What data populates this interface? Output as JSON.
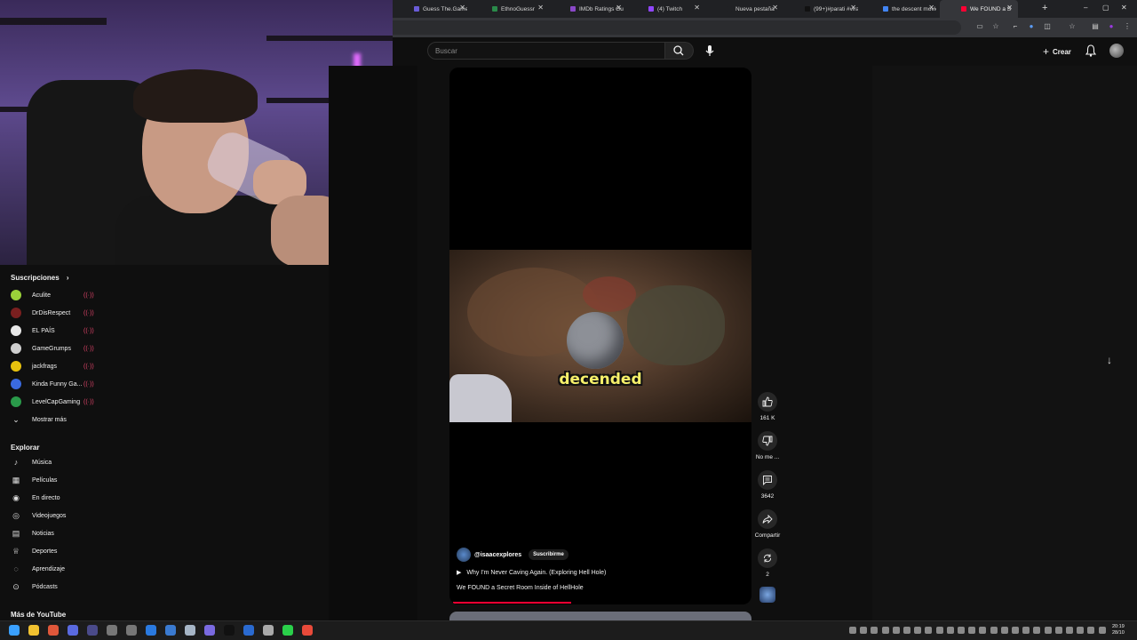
{
  "browser": {
    "tabs": [
      {
        "label": "Guess The.Game #",
        "icon_color": "#6a5cd8"
      },
      {
        "label": "EthnoGuessr",
        "icon_color": "#2a8a4a"
      },
      {
        "label": "IMDb Ratings Gues",
        "icon_color": "#8a48c8"
      },
      {
        "label": "(4) Twitch",
        "icon_color": "#9146ff"
      },
      {
        "label": "Nueva pestaña",
        "icon_color": "#202124"
      },
      {
        "label": "(99+)#parati #viral",
        "icon_color": "#111111"
      },
      {
        "label": "the descent movie",
        "icon_color": "#4285f4"
      },
      {
        "label": "We FOUND a S",
        "icon_color": "#ff0033"
      }
    ],
    "active_tab_index": 7
  },
  "header": {
    "search_placeholder": "Buscar",
    "create_label": "Crear"
  },
  "sidebar": {
    "subscriptions_title": "Suscripciones",
    "subscriptions": [
      {
        "name": "Aculite",
        "color": "#9ad23a"
      },
      {
        "name": "DrDisRespect",
        "color": "#7a1f1f"
      },
      {
        "name": "EL PAÍS",
        "color": "#e8e8e8"
      },
      {
        "name": "GameGrumps",
        "color": "#cfcfcf"
      },
      {
        "name": "jackfrags",
        "color": "#e8c20e"
      },
      {
        "name": "Kinda Funny Ga...",
        "color": "#3a6ae0"
      },
      {
        "name": "LevelCapGaming",
        "color": "#2a9a4a"
      }
    ],
    "show_more": "Mostrar más",
    "explore_title": "Explorar",
    "explore": [
      {
        "label": "Música",
        "icon": "music-note-icon"
      },
      {
        "label": "Películas",
        "icon": "film-icon"
      },
      {
        "label": "En directo",
        "icon": "live-icon"
      },
      {
        "label": "Videojuegos",
        "icon": "gamepad-icon"
      },
      {
        "label": "Noticias",
        "icon": "news-icon"
      },
      {
        "label": "Deportes",
        "icon": "trophy-icon"
      },
      {
        "label": "Aprendizaje",
        "icon": "lightbulb-icon"
      },
      {
        "label": "Pódcasts",
        "icon": "podcast-icon"
      }
    ],
    "more_title": "Más de YouTube"
  },
  "short": {
    "caption": "decended",
    "channel": "@isaacexplores",
    "subscribe_label": "Suscribirme",
    "playlist": "Why I'm Never Caving Again. (Exploring Hell Hole)",
    "title": "We FOUND a Secret Room Inside of HellHole",
    "progress_fraction": 0.4
  },
  "actions": {
    "likes": "161 K",
    "dislike": "No me ...",
    "comments": "3642",
    "share": "Compartir",
    "remix": "2"
  },
  "taskbar": {
    "time": "20:19",
    "date": "28/10"
  }
}
